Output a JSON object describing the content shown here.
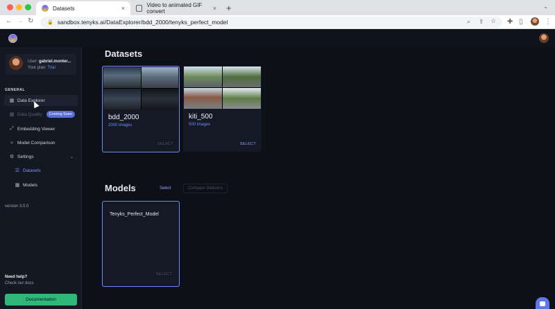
{
  "browser": {
    "tabs": [
      {
        "title": "Datasets",
        "active": true
      },
      {
        "title": "Video to animated GIF convert",
        "active": false
      }
    ],
    "close_glyph": "×",
    "new_tab_glyph": "+",
    "url": "sandbox.tenyks.ai/DataExplorer/bdd_2000/tenyks_perfect_model"
  },
  "sidebar": {
    "user": {
      "prefix": "User:",
      "name": "gabriel.monter...",
      "plan_prefix": "Your plan:",
      "plan": "Trial"
    },
    "section": "GENERAL",
    "items": [
      {
        "label": "Data Explorer",
        "icon": "table-icon"
      },
      {
        "label": "Data Quality",
        "icon": "quality-icon",
        "badge": "Coming Soon"
      },
      {
        "label": "Embedding Viewer",
        "icon": "embedding-icon"
      },
      {
        "label": "Model Comparison",
        "icon": "compare-icon"
      },
      {
        "label": "Settings",
        "icon": "gear-icon"
      }
    ],
    "subitems": [
      {
        "label": "Datasets",
        "icon": "list-icon"
      },
      {
        "label": "Models",
        "icon": "grid-icon"
      }
    ],
    "version": "version 3.0.0",
    "help_title": "Need help?",
    "help_link": "Check our docs",
    "doc_button": "Documentation"
  },
  "main": {
    "datasets_title": "Datasets",
    "datasets": [
      {
        "name": "bdd_2000",
        "count": "2000 images",
        "select": "SELECT",
        "selected": true
      },
      {
        "name": "kiti_500",
        "count": "500 images",
        "select": "SELECT",
        "selected": false
      }
    ],
    "models_title": "Models",
    "models_select": "Select",
    "compare_button": "Compare Statistics",
    "models": [
      {
        "name": "Tenyks_Perfect_Model",
        "select": "SELECT"
      }
    ]
  },
  "colors": {
    "accent": "#6f8cff",
    "green": "#2fb87a",
    "background": "#0d1117",
    "badge": "#5a6fd6"
  }
}
